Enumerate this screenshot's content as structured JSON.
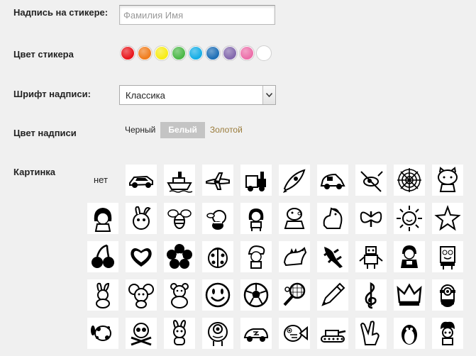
{
  "form": {
    "sticker_text_label": "Надпись на стикере:",
    "sticker_text_placeholder": "Фамилия Имя",
    "sticker_color_label": "Цвет стикера",
    "font_label": "Шрифт надписи:",
    "font_selected": "Классика",
    "text_color_label": "Цвет надписи",
    "picture_label": "Картинка"
  },
  "sticker_colors": [
    {
      "name": "red",
      "hex": "#e8161c"
    },
    {
      "name": "orange",
      "hex": "#f07d1d"
    },
    {
      "name": "yellow",
      "hex": "#f7ec16"
    },
    {
      "name": "green",
      "hex": "#4cb848"
    },
    {
      "name": "light-blue",
      "hex": "#16aee6"
    },
    {
      "name": "blue",
      "hex": "#1f6fb6"
    },
    {
      "name": "purple",
      "hex": "#8369ad"
    },
    {
      "name": "pink",
      "hex": "#ec6fa9"
    },
    {
      "name": "white",
      "hex": "#ffffff"
    }
  ],
  "text_colors": {
    "black": "Черный",
    "white": "Белый",
    "gold": "Золотой",
    "selected": "white"
  },
  "pictures": {
    "none_label": "нет",
    "icons": [
      "race-car",
      "steamboat",
      "airplane",
      "toy-train",
      "rocket",
      "small-car",
      "helicopter",
      "spiderweb",
      "hello-kitty",
      "masha",
      "smeshariki-krosh",
      "bee",
      "puppy-bee",
      "dora",
      "peppa-pig",
      "pony",
      "butterfly",
      "sun",
      "starfish",
      "cherries",
      "heart",
      "flower",
      "ladybug",
      "smurf",
      "dinosaur",
      "lizard",
      "robot",
      "ben10",
      "spongebob",
      "rabbit",
      "jerry-mouse",
      "teddy-bear",
      "smiley",
      "soccer-ball",
      "tennis-racket",
      "pencil",
      "treble-clef",
      "crown",
      "minion",
      "blues-clues",
      "skull",
      "luntik",
      "mike-wazowski",
      "lightning-mcqueen",
      "flounder",
      "tank",
      "victory-hand",
      "penguin",
      "fixie"
    ]
  }
}
